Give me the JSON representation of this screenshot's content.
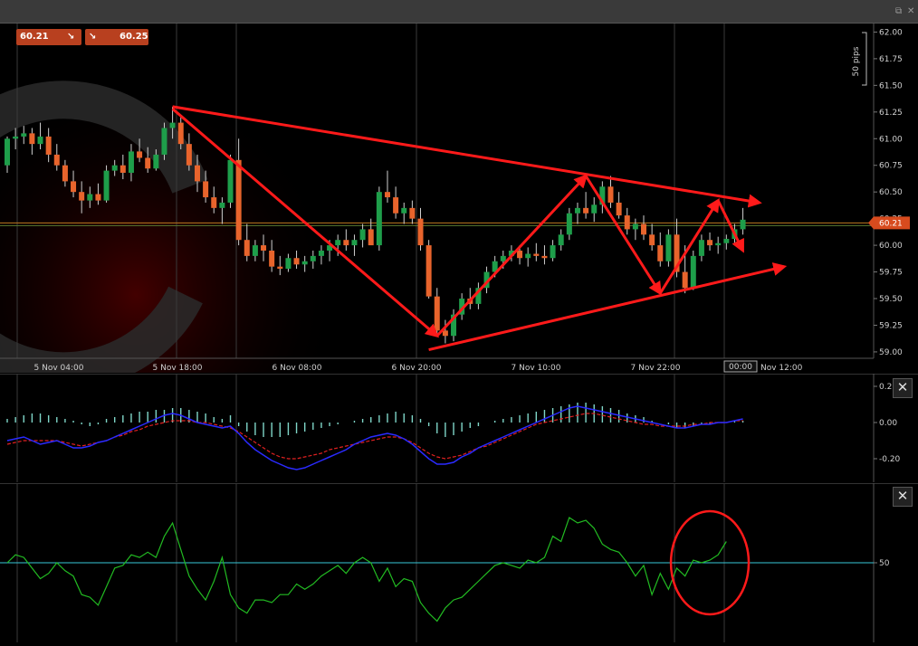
{
  "top_badges": {
    "bid": "60.21",
    "ask": "60.25",
    "arrow_down": "↘"
  },
  "current_price_label": "60.21",
  "current_price": 60.21,
  "pips_label": "50 pips",
  "time_marker": "00:00",
  "icons": [
    "window-restore-icon",
    "window-close-icon",
    "arrow-down-right-icon",
    "close-icon"
  ],
  "colors": {
    "bull": "#1e9e4a",
    "bear": "#e8642c",
    "annotation": "#ff1a1a",
    "macd_hist": "#7fd6c8",
    "macd_line": "#2a2aff",
    "signal_line": "#e02020",
    "osc_line": "#22bb22",
    "osc_level": "#38c8d8"
  },
  "chart_data": [
    {
      "type": "candlestick",
      "y_ticks": [
        "62.00",
        "61.75",
        "61.50",
        "61.25",
        "61.00",
        "60.75",
        "60.50",
        "60.25",
        "60.00",
        "59.75",
        "59.50",
        "59.25",
        "59.00"
      ],
      "x_ticks": [
        "5 Nov 04:00",
        "5 Nov 18:00",
        "6 Nov 08:00",
        "6 Nov 20:00",
        "7 Nov 10:00",
        "7 Nov 22:00",
        "10 Nov 12:00"
      ],
      "ylim": [
        58.94,
        62.08
      ],
      "grid": true,
      "ohlc": [
        [
          60.75,
          61.02,
          60.68,
          61.0
        ],
        [
          61.0,
          61.1,
          60.9,
          61.02
        ],
        [
          61.02,
          61.12,
          60.95,
          61.05
        ],
        [
          61.05,
          61.1,
          60.85,
          60.95
        ],
        [
          60.95,
          61.15,
          60.9,
          61.02
        ],
        [
          61.02,
          61.1,
          60.78,
          60.85
        ],
        [
          60.85,
          60.95,
          60.7,
          60.75
        ],
        [
          60.75,
          60.8,
          60.55,
          60.6
        ],
        [
          60.6,
          60.7,
          60.45,
          60.5
        ],
        [
          60.5,
          60.6,
          60.3,
          60.42
        ],
        [
          60.42,
          60.55,
          60.35,
          60.48
        ],
        [
          60.48,
          60.58,
          60.38,
          60.42
        ],
        [
          60.42,
          60.75,
          60.4,
          60.7
        ],
        [
          60.7,
          60.8,
          60.65,
          60.75
        ],
        [
          60.75,
          60.85,
          60.62,
          60.68
        ],
        [
          60.68,
          60.95,
          60.6,
          60.88
        ],
        [
          60.88,
          61.0,
          60.78,
          60.82
        ],
        [
          60.82,
          60.92,
          60.68,
          60.72
        ],
        [
          60.72,
          60.9,
          60.7,
          60.85
        ],
        [
          60.85,
          61.15,
          60.8,
          61.1
        ],
        [
          61.1,
          61.3,
          61.0,
          61.15
        ],
        [
          61.15,
          61.2,
          60.9,
          60.95
        ],
        [
          60.95,
          61.05,
          60.7,
          60.75
        ],
        [
          60.75,
          60.85,
          60.5,
          60.6
        ],
        [
          60.6,
          60.7,
          60.4,
          60.45
        ],
        [
          60.45,
          60.55,
          60.3,
          60.35
        ],
        [
          60.35,
          60.45,
          60.2,
          60.4
        ],
        [
          60.4,
          60.85,
          60.35,
          60.8
        ],
        [
          60.8,
          61.0,
          60.0,
          60.05
        ],
        [
          60.05,
          60.2,
          59.85,
          59.9
        ],
        [
          59.9,
          60.05,
          59.85,
          60.0
        ],
        [
          60.0,
          60.1,
          59.85,
          59.95
        ],
        [
          59.95,
          60.05,
          59.75,
          59.8
        ],
        [
          59.8,
          59.9,
          59.72,
          59.78
        ],
        [
          59.78,
          59.92,
          59.75,
          59.88
        ],
        [
          59.88,
          59.95,
          59.78,
          59.82
        ],
        [
          59.82,
          59.9,
          59.75,
          59.85
        ],
        [
          59.85,
          59.95,
          59.78,
          59.9
        ],
        [
          59.9,
          60.0,
          59.82,
          59.95
        ],
        [
          59.95,
          60.05,
          59.85,
          60.0
        ],
        [
          60.0,
          60.1,
          59.9,
          60.05
        ],
        [
          60.05,
          60.15,
          59.95,
          60.0
        ],
        [
          60.0,
          60.1,
          59.9,
          60.05
        ],
        [
          60.05,
          60.2,
          59.98,
          60.15
        ],
        [
          60.15,
          60.25,
          60.05,
          60.0
        ],
        [
          60.0,
          60.55,
          59.95,
          60.5
        ],
        [
          60.5,
          60.7,
          60.4,
          60.45
        ],
        [
          60.45,
          60.55,
          60.25,
          60.3
        ],
        [
          60.3,
          60.4,
          60.2,
          60.35
        ],
        [
          60.35,
          60.42,
          60.2,
          60.25
        ],
        [
          60.25,
          60.35,
          59.95,
          60.0
        ],
        [
          60.0,
          60.05,
          59.5,
          59.52
        ],
        [
          59.52,
          59.6,
          59.15,
          59.2
        ],
        [
          59.2,
          59.3,
          59.08,
          59.15
        ],
        [
          59.15,
          59.4,
          59.1,
          59.35
        ],
        [
          59.35,
          59.55,
          59.3,
          59.5
        ],
        [
          59.5,
          59.6,
          59.4,
          59.45
        ],
        [
          59.45,
          59.65,
          59.4,
          59.6
        ],
        [
          59.6,
          59.8,
          59.55,
          59.75
        ],
        [
          59.75,
          59.9,
          59.7,
          59.85
        ],
        [
          59.85,
          59.95,
          59.78,
          59.9
        ],
        [
          59.9,
          60.0,
          59.85,
          59.95
        ],
        [
          59.95,
          60.0,
          59.82,
          59.88
        ],
        [
          59.88,
          59.98,
          59.8,
          59.92
        ],
        [
          59.92,
          60.02,
          59.85,
          59.9
        ],
        [
          59.9,
          60.0,
          59.82,
          59.88
        ],
        [
          59.88,
          60.05,
          59.85,
          60.0
        ],
        [
          60.0,
          60.15,
          59.95,
          60.1
        ],
        [
          60.1,
          60.35,
          60.05,
          60.3
        ],
        [
          60.3,
          60.4,
          60.2,
          60.35
        ],
        [
          60.35,
          60.5,
          60.25,
          60.3
        ],
        [
          60.3,
          60.45,
          60.22,
          60.38
        ],
        [
          60.38,
          60.6,
          60.3,
          60.55
        ],
        [
          60.55,
          60.65,
          60.35,
          60.4
        ],
        [
          60.4,
          60.5,
          60.25,
          60.28
        ],
        [
          60.28,
          60.35,
          60.1,
          60.15
        ],
        [
          60.15,
          60.25,
          60.05,
          60.2
        ],
        [
          60.2,
          60.28,
          60.05,
          60.1
        ],
        [
          60.1,
          60.2,
          59.95,
          60.0
        ],
        [
          60.0,
          60.12,
          59.8,
          59.85
        ],
        [
          59.85,
          60.15,
          59.8,
          60.1
        ],
        [
          60.1,
          60.25,
          59.7,
          59.75
        ],
        [
          59.75,
          60.0,
          59.55,
          59.6
        ],
        [
          59.6,
          59.95,
          59.58,
          59.9
        ],
        [
          59.9,
          60.1,
          59.85,
          60.05
        ],
        [
          60.05,
          60.12,
          59.95,
          60.0
        ],
        [
          60.0,
          60.08,
          59.92,
          60.02
        ],
        [
          60.02,
          60.1,
          59.96,
          60.06
        ],
        [
          60.06,
          60.2,
          60.0,
          60.15
        ],
        [
          60.15,
          60.35,
          60.1,
          60.24
        ]
      ],
      "annotations": [
        {
          "kind": "line",
          "from": [
            20,
            61.3
          ],
          "to": [
            91,
            60.4
          ],
          "arrow": true
        },
        {
          "kind": "line",
          "from": [
            20,
            61.28
          ],
          "to": [
            52,
            59.15
          ],
          "arrow": true
        },
        {
          "kind": "line",
          "from": [
            52,
            59.15
          ],
          "to": [
            70,
            60.65
          ],
          "arrow": true
        },
        {
          "kind": "line",
          "from": [
            70,
            60.65
          ],
          "to": [
            79,
            59.55
          ],
          "arrow": true
        },
        {
          "kind": "line",
          "from": [
            79,
            59.55
          ],
          "to": [
            86,
            60.42
          ],
          "arrow": true
        },
        {
          "kind": "line",
          "from": [
            86,
            60.42
          ],
          "to": [
            89,
            59.95
          ],
          "arrow": true
        },
        {
          "kind": "line",
          "from": [
            51,
            59.02
          ],
          "to": [
            94,
            59.8
          ],
          "arrow": true
        }
      ]
    },
    {
      "type": "bar+line",
      "name": "macd",
      "y_ticks": [
        "0.20",
        "0.00",
        "-0.20"
      ],
      "ylim": [
        -0.33,
        0.27
      ],
      "histogram": [
        0.02,
        0.03,
        0.04,
        0.05,
        0.05,
        0.04,
        0.03,
        0.02,
        0.01,
        -0.01,
        -0.02,
        -0.01,
        0.02,
        0.03,
        0.04,
        0.05,
        0.06,
        0.06,
        0.07,
        0.07,
        0.08,
        0.08,
        0.07,
        0.06,
        0.05,
        0.03,
        0.02,
        0.04,
        -0.02,
        -0.05,
        -0.07,
        -0.08,
        -0.08,
        -0.08,
        -0.07,
        -0.06,
        -0.05,
        -0.04,
        -0.03,
        -0.02,
        -0.01,
        0.0,
        0.01,
        0.02,
        0.03,
        0.04,
        0.05,
        0.06,
        0.05,
        0.04,
        0.02,
        -0.02,
        -0.06,
        -0.08,
        -0.07,
        -0.05,
        -0.03,
        -0.02,
        0.0,
        0.01,
        0.02,
        0.03,
        0.04,
        0.05,
        0.06,
        0.07,
        0.08,
        0.09,
        0.1,
        0.11,
        0.11,
        0.1,
        0.09,
        0.08,
        0.07,
        0.05,
        0.04,
        0.03,
        0.01,
        0.0,
        -0.01,
        -0.03,
        -0.03,
        -0.02,
        -0.01,
        -0.01,
        0.0,
        0.0,
        0.01,
        0.01
      ],
      "macd_line": [
        -0.1,
        -0.09,
        -0.08,
        -0.1,
        -0.12,
        -0.11,
        -0.1,
        -0.12,
        -0.14,
        -0.14,
        -0.13,
        -0.11,
        -0.1,
        -0.08,
        -0.06,
        -0.04,
        -0.02,
        0.0,
        0.02,
        0.04,
        0.05,
        0.04,
        0.02,
        0.0,
        -0.01,
        -0.02,
        -0.03,
        -0.02,
        -0.06,
        -0.11,
        -0.15,
        -0.18,
        -0.21,
        -0.23,
        -0.25,
        -0.26,
        -0.25,
        -0.23,
        -0.21,
        -0.19,
        -0.17,
        -0.15,
        -0.12,
        -0.1,
        -0.08,
        -0.07,
        -0.06,
        -0.07,
        -0.09,
        -0.12,
        -0.16,
        -0.2,
        -0.23,
        -0.23,
        -0.22,
        -0.19,
        -0.17,
        -0.14,
        -0.12,
        -0.1,
        -0.08,
        -0.06,
        -0.04,
        -0.02,
        0.0,
        0.02,
        0.04,
        0.06,
        0.08,
        0.09,
        0.08,
        0.07,
        0.06,
        0.05,
        0.04,
        0.03,
        0.02,
        0.01,
        0.0,
        -0.01,
        -0.02,
        -0.03,
        -0.03,
        -0.02,
        -0.01,
        -0.01,
        0.0,
        0.0,
        0.01,
        0.02
      ],
      "signal_line": [
        -0.12,
        -0.11,
        -0.1,
        -0.1,
        -0.1,
        -0.1,
        -0.1,
        -0.11,
        -0.12,
        -0.13,
        -0.12,
        -0.11,
        -0.1,
        -0.08,
        -0.07,
        -0.05,
        -0.04,
        -0.02,
        -0.01,
        0.0,
        0.01,
        0.01,
        0.01,
        0.0,
        0.0,
        -0.01,
        -0.02,
        -0.03,
        -0.05,
        -0.08,
        -0.11,
        -0.14,
        -0.17,
        -0.19,
        -0.2,
        -0.2,
        -0.19,
        -0.18,
        -0.17,
        -0.15,
        -0.14,
        -0.13,
        -0.12,
        -0.11,
        -0.1,
        -0.09,
        -0.08,
        -0.08,
        -0.09,
        -0.11,
        -0.14,
        -0.17,
        -0.19,
        -0.2,
        -0.19,
        -0.18,
        -0.16,
        -0.14,
        -0.13,
        -0.11,
        -0.09,
        -0.07,
        -0.05,
        -0.03,
        -0.01,
        0.0,
        0.01,
        0.02,
        0.03,
        0.04,
        0.05,
        0.05,
        0.04,
        0.03,
        0.02,
        0.01,
        0.0,
        -0.01,
        -0.01,
        -0.02,
        -0.02,
        -0.02,
        -0.02,
        -0.01,
        -0.01,
        0.0,
        0.0,
        0.0,
        0.01,
        0.01
      ]
    },
    {
      "type": "line",
      "name": "oscillator",
      "y_ticks": [
        "50"
      ],
      "ylim": [
        20,
        80
      ],
      "level": 50,
      "values": [
        50,
        53,
        52,
        48,
        44,
        46,
        50,
        47,
        45,
        38,
        37,
        34,
        41,
        48,
        49,
        53,
        52,
        54,
        52,
        60,
        65,
        55,
        45,
        40,
        36,
        43,
        52,
        38,
        33,
        31,
        36,
        36,
        35,
        38,
        38,
        42,
        40,
        42,
        45,
        47,
        49,
        46,
        50,
        52,
        50,
        43,
        48,
        41,
        44,
        43,
        35,
        31,
        28,
        33,
        36,
        37,
        40,
        43,
        46,
        49,
        50,
        49,
        48,
        51,
        50,
        52,
        60,
        58,
        67,
        65,
        66,
        63,
        57,
        55,
        54,
        50,
        45,
        49,
        38,
        46,
        40,
        48,
        45,
        51,
        50,
        51,
        53,
        58
      ]
    }
  ]
}
